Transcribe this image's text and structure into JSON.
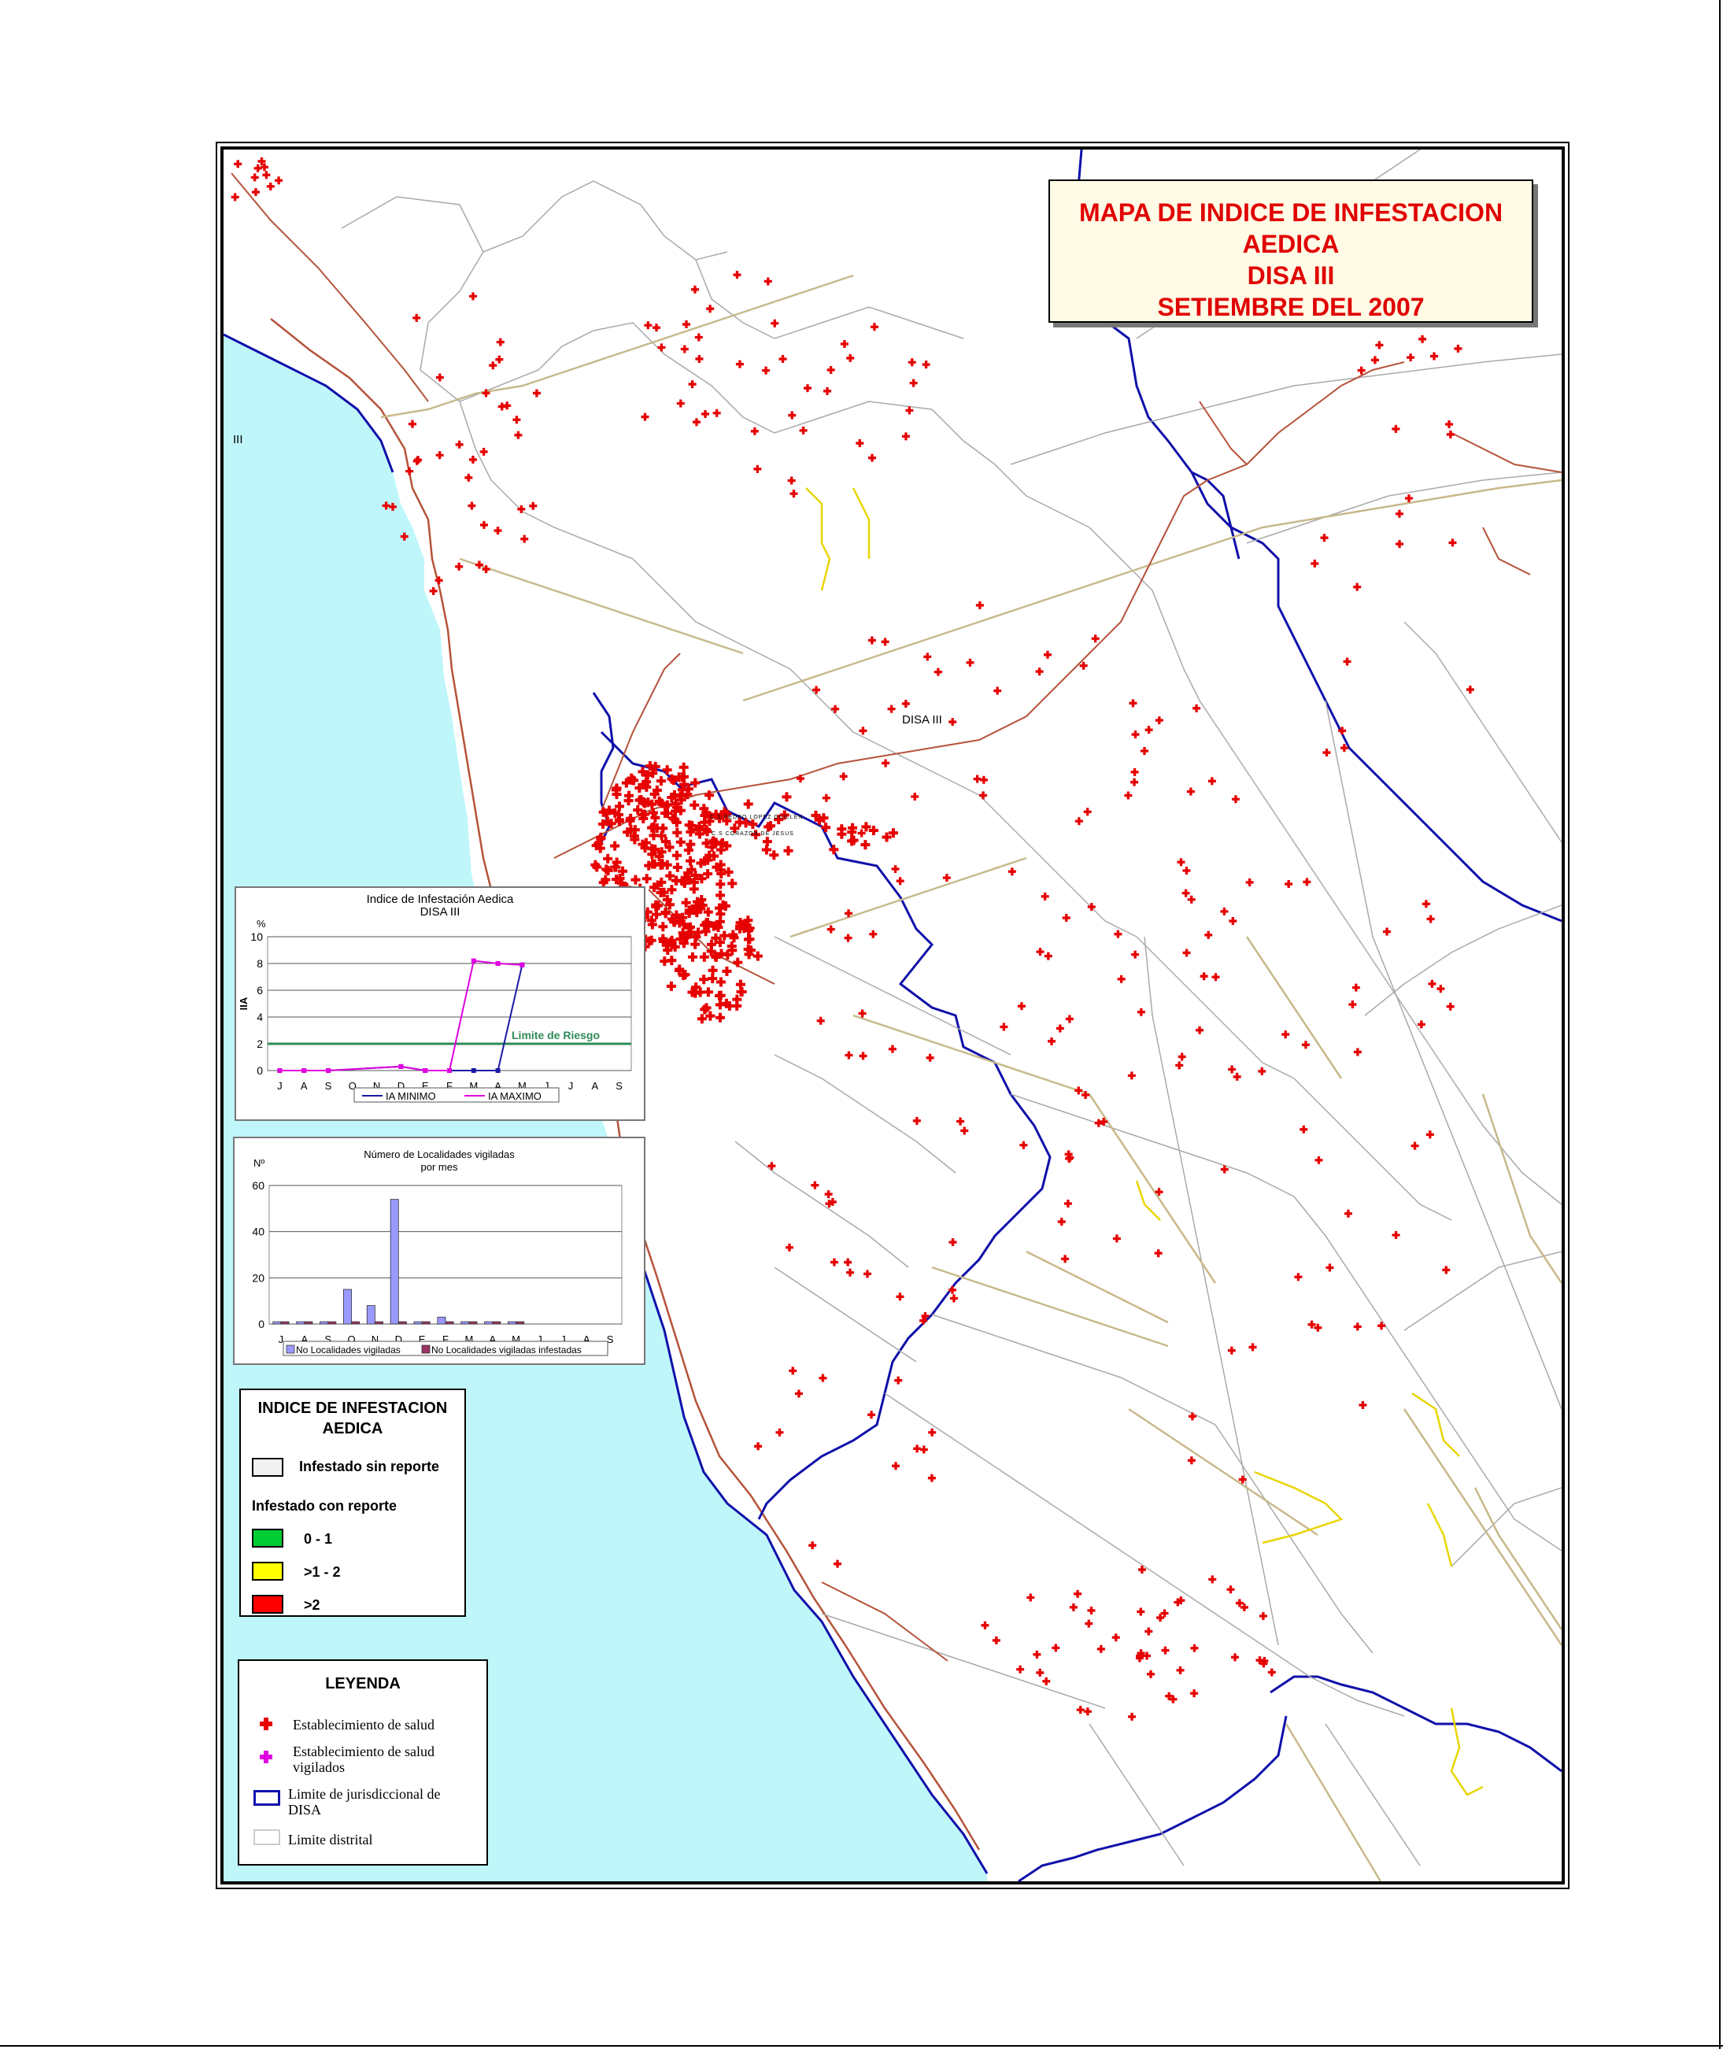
{
  "title": {
    "lines": [
      "MAPA DE INDICE DE INFESTACION",
      "AEDICA",
      "DISA III",
      "SETIEMBRE DEL 2007"
    ]
  },
  "map_labels": {
    "disa_center": "DISA III",
    "left_edge": "III",
    "centro1": "C.S PEDRO LOPEZ GUILLEN",
    "centro2": "C.S CORAZON DE JESUS"
  },
  "colors": {
    "sea": "#bff6fa",
    "disa_boundary": "#0000cc",
    "district_boundary": "#a9a9a9",
    "road_primary": "#b5533a",
    "road_secondary": "#c8b98a",
    "road_yellow": "#e8d500",
    "health_marker": "#e60000",
    "surveyed_marker": "#e000e0",
    "title_text": "#e00000"
  },
  "chart_data": [
    {
      "type": "line",
      "title": "Indice de Infestación Aedica",
      "subtitle": "DISA III",
      "ylabel": "IIA",
      "yunit": "%",
      "ylim": [
        0,
        10
      ],
      "yticks": [
        0,
        2,
        4,
        6,
        8,
        10
      ],
      "categories": [
        "J",
        "A",
        "S",
        "O",
        "N",
        "D",
        "E",
        "F",
        "M",
        "A",
        "M",
        "J",
        "J",
        "A",
        "S"
      ],
      "series": [
        {
          "name": "IA MINIMO",
          "color": "#1a1aa6",
          "values": [
            0,
            0,
            0,
            null,
            null,
            0.3,
            0,
            0,
            0,
            0,
            7.9,
            null,
            null,
            null,
            null
          ]
        },
        {
          "name": "IA MAXIMO",
          "color": "#e000e0",
          "values": [
            0,
            0,
            0,
            null,
            null,
            0.3,
            0,
            0,
            8.2,
            8.0,
            7.9,
            null,
            null,
            null,
            null
          ]
        }
      ],
      "reference_line": {
        "label": "Limite de Riesgo",
        "value": 2,
        "color": "#2e8b57"
      },
      "grid": true,
      "legend": "bottom"
    },
    {
      "type": "bar",
      "title": "Número de Localidades vigiladas",
      "subtitle": "por mes",
      "yunit": "Nº",
      "ylim": [
        0,
        60
      ],
      "yticks": [
        0,
        20,
        40,
        60
      ],
      "categories": [
        "J",
        "A",
        "S",
        "O",
        "N",
        "D",
        "E",
        "F",
        "M",
        "A",
        "M",
        "J",
        "J",
        "A",
        "S"
      ],
      "series": [
        {
          "name": "No Localidades vigiladas",
          "color": "#9999ff",
          "values": [
            1,
            1,
            1,
            15,
            8,
            54,
            1,
            3,
            1,
            1,
            1,
            0,
            0,
            0,
            0
          ]
        },
        {
          "name": "No Localidades vigiladas infestadas",
          "color": "#993366",
          "values": [
            1,
            1,
            1,
            1,
            1,
            1,
            1,
            1,
            1,
            1,
            1,
            0,
            0,
            0,
            0
          ]
        }
      ],
      "grid": true,
      "legend": "bottom"
    }
  ],
  "legend_index": {
    "title_line1": "INDICE DE INFESTACION",
    "title_line2": "AEDICA",
    "item_gray": "Infestado sin reporte",
    "subheading": "Infestado con reporte",
    "item_green": "0 - 1",
    "item_yellow": ">1 - 2",
    "item_red": ">2",
    "colors": {
      "gray": "#f0f0f0",
      "green": "#00cc33",
      "yellow": "#ffff00",
      "red": "#ff0000"
    }
  },
  "legend_main": {
    "title": "LEYENDA",
    "item1": "Establecimiento de salud",
    "item2_line1": "Establecimiento de salud",
    "item2_line2": "vigilados",
    "item3_line1": "Limite de jurisdiccional de",
    "item3_line2": "DISA",
    "item4": "Limite distrital"
  }
}
